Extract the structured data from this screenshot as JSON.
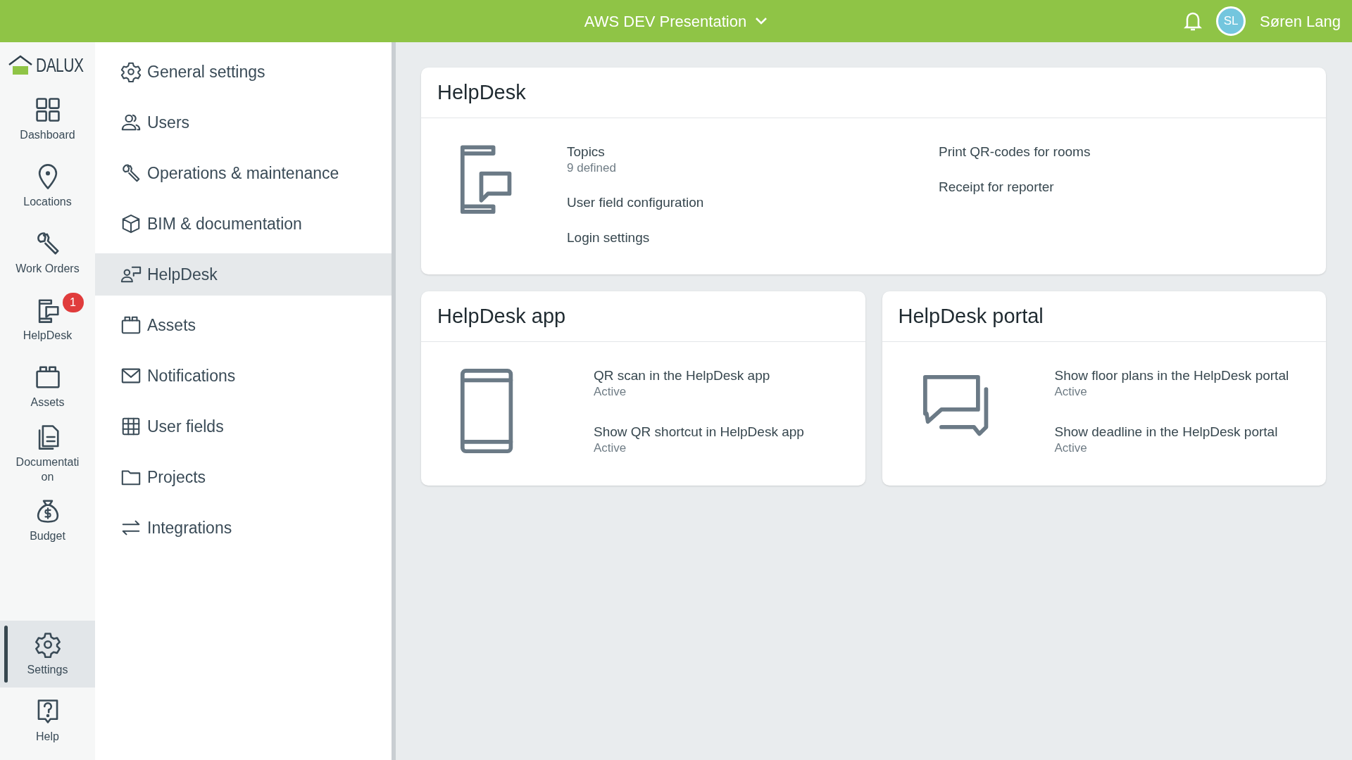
{
  "top_bar": {
    "project": "AWS DEV Presentation",
    "user_initials": "SL",
    "user_name": "Søren Lang"
  },
  "logo": {
    "text": "DALUX"
  },
  "rail": [
    {
      "kind": "dashboard",
      "label": "Dashboard",
      "selected": false
    },
    {
      "kind": "location",
      "label": "Locations",
      "selected": false
    },
    {
      "kind": "wrench",
      "label": "Work Orders",
      "selected": false
    },
    {
      "kind": "helpdesk",
      "label": "HelpDesk",
      "selected": false,
      "badge": "1"
    },
    {
      "kind": "assets",
      "label": "Assets",
      "selected": false
    },
    {
      "kind": "document",
      "label": "Documentation",
      "selected": false
    },
    {
      "kind": "budget",
      "label": "Budget",
      "selected": false
    }
  ],
  "rail_bottom": [
    {
      "kind": "gear",
      "label": "Settings",
      "selected": true
    },
    {
      "kind": "help",
      "label": "Help",
      "selected": false
    }
  ],
  "settings_menu": [
    {
      "kind": "gear",
      "label": "General settings",
      "selected": false
    },
    {
      "kind": "users",
      "label": "Users",
      "selected": false
    },
    {
      "kind": "wrench",
      "label": "Operations & maintenance",
      "selected": false
    },
    {
      "kind": "cube",
      "label": "BIM & documentation",
      "selected": false
    },
    {
      "kind": "person-sign",
      "label": "HelpDesk",
      "selected": true
    },
    {
      "kind": "assets",
      "label": "Assets",
      "selected": false
    },
    {
      "kind": "mail",
      "label": "Notifications",
      "selected": false
    },
    {
      "kind": "grid",
      "label": "User fields",
      "selected": false
    },
    {
      "kind": "folder",
      "label": "Projects",
      "selected": false
    },
    {
      "kind": "arrows",
      "label": "Integrations",
      "selected": false
    }
  ],
  "cards": [
    {
      "title": "HelpDesk",
      "kind": "phone-chat",
      "columns": [
        [
          {
            "label": "Topics",
            "status": "9 defined"
          },
          {
            "label": "User field configuration"
          },
          {
            "label": "Login settings"
          }
        ],
        [
          {
            "label": "Print QR-codes for rooms"
          },
          {
            "label": "Receipt for reporter"
          }
        ]
      ]
    },
    {
      "title": "HelpDesk app",
      "kind": "phone",
      "columns": [
        [
          {
            "label": "QR scan in the HelpDesk app",
            "status": "Active"
          },
          {
            "label": "Show QR shortcut in HelpDesk app",
            "status": "Active"
          }
        ]
      ]
    },
    {
      "title": "HelpDesk portal",
      "kind": "chat",
      "columns": [
        [
          {
            "label": "Show floor plans in the HelpDesk portal",
            "status": "Active"
          },
          {
            "label": "Show deadline in the HelpDesk portal",
            "status": "Active"
          }
        ]
      ]
    }
  ]
}
